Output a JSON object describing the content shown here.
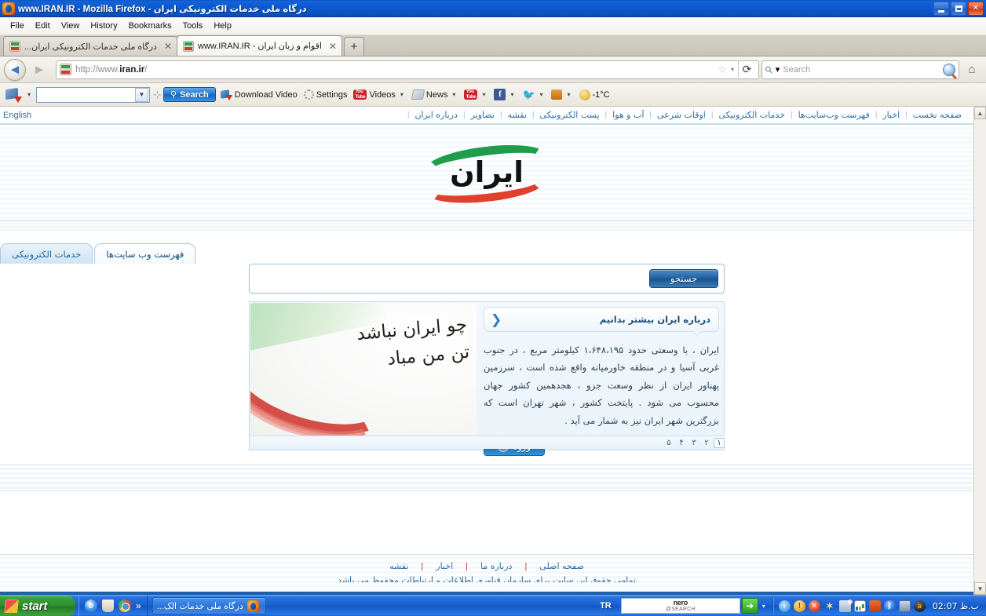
{
  "window": {
    "title": "درگاه ملی خدمات الکترونیکی ایران - www.IRAN.IR - Mozilla Firefox",
    "minimize": "_",
    "maximize": "□",
    "close": "✕"
  },
  "menubar": {
    "items": [
      {
        "label": "File"
      },
      {
        "label": "Edit"
      },
      {
        "label": "View"
      },
      {
        "label": "History"
      },
      {
        "label": "Bookmarks"
      },
      {
        "label": "Tools"
      },
      {
        "label": "Help"
      }
    ]
  },
  "tabs": {
    "items": [
      {
        "label": "درگاه ملی خدمات الکترونیکی ایران...",
        "close": "✕",
        "active": false
      },
      {
        "label": "اقوام و زبان ایران - www.IRAN.IR",
        "close": "✕",
        "active": true
      }
    ],
    "new_tab": "+"
  },
  "navbar": {
    "back": "◄",
    "forward": "►",
    "url_protocol": "http://www.",
    "url_domain": "iran.ir",
    "url_path": "/",
    "star": "☆",
    "star_caret": "▾",
    "reload": "⟳",
    "search_placeholder": "Search",
    "search_caret": "▾",
    "home": "⌂"
  },
  "addonbar": {
    "idm_caret": "▾",
    "combo_value": "",
    "combo_caret": "▼",
    "separator": "⊹",
    "search_button": "Search",
    "search_magnifier": "🔍",
    "items": [
      {
        "label": "Download Video",
        "icon": "download-video-icon",
        "caret": false
      },
      {
        "label": "Settings",
        "icon": "gear-icon",
        "caret": false
      },
      {
        "label": "Videos",
        "icon": "youtube-icon",
        "caret": true
      },
      {
        "label": "News",
        "icon": "news-icon",
        "caret": true
      },
      {
        "label": "",
        "icon": "youtube-icon",
        "caret": true
      },
      {
        "label": "",
        "icon": "facebook-icon",
        "caret": true
      },
      {
        "label": "",
        "icon": "twitter-icon",
        "caret": true
      },
      {
        "label": "",
        "icon": "shopping-icon",
        "caret": true
      },
      {
        "label": "-1°C",
        "icon": "weather-icon",
        "caret": false
      }
    ]
  },
  "page": {
    "english_link": "English",
    "topnav": [
      {
        "label": "صفحه نخست"
      },
      {
        "label": "اخبار"
      },
      {
        "label": "فهرست وب‌سایت‌ها"
      },
      {
        "label": "خدمات الکترونیکی"
      },
      {
        "label": "اوقات شرعی"
      },
      {
        "label": "آب و هوا"
      },
      {
        "label": "پست الکترونیکی"
      },
      {
        "label": "نقشه"
      },
      {
        "label": "تصاویر"
      },
      {
        "label": "درباره ایران"
      }
    ],
    "topnav_separator": "|",
    "logo_text": "ایران",
    "content_tabs": [
      {
        "label": "فهرست وب سایت‌ها",
        "selected": true
      },
      {
        "label": "خدمات الکترونیکی",
        "selected": false
      }
    ],
    "search": {
      "button_label": "جستجو",
      "input_value": "",
      "placeholder": ""
    },
    "banner": {
      "line1": "چو ایران نباشد",
      "line2": "تن من مباد"
    },
    "article": {
      "title": "درباره ایران بیشتر بدانیم",
      "arrow": "❮",
      "body": "ایران ، با وسعتی حدود ۱،۶۴۸،۱۹۵ کیلومتر مربع ، در جنوب غربی آسیا و در منطقه خاورمیانه واقع شده است ، سرزمین پهناور ایران از نظر وسعت جزو ، هجدهمین کشور جهان محسوب می شود . پایتخت کشور ، شهر تهران است که بزرگترین شهر ایران نیز به شمار می آید .",
      "enter_button": "ورود",
      "enter_arrow": "◄"
    },
    "pagination": {
      "pages": [
        "۱",
        "۲",
        "۳",
        "۴",
        "۵"
      ],
      "active_index": 0
    },
    "footer": {
      "links": [
        {
          "label": "صفحه اصلی"
        },
        {
          "label": "درباره ما"
        },
        {
          "label": "اخبار"
        },
        {
          "label": "نقشه"
        }
      ],
      "separator": "|",
      "copyright": "تمامی حقوق این سایت برای سازمان فناوری اطلاعات و ارتباطات محفوظ می باشد"
    }
  },
  "scrollbar": {
    "up": "▲",
    "down": "▼"
  },
  "taskbar": {
    "start_label": "start",
    "quicklaunch_more": "»",
    "window_button": "درگاه ملی خدمات الک...",
    "language": "TR",
    "nero_line1": "nero",
    "nero_line2": "@SEARCH",
    "nero_go": "➜",
    "nero_caret": "▾",
    "clock": "02:07 ب.ظ"
  },
  "colors": {
    "title_blue": "#0d5ad0",
    "accent_blue": "#1d7fc6",
    "link_blue": "#2f6ea8",
    "flag_green": "#1f9d4b",
    "flag_red": "#e2402f",
    "taskbar_blue": "#175fd0",
    "start_green": "#2f8f2f"
  }
}
